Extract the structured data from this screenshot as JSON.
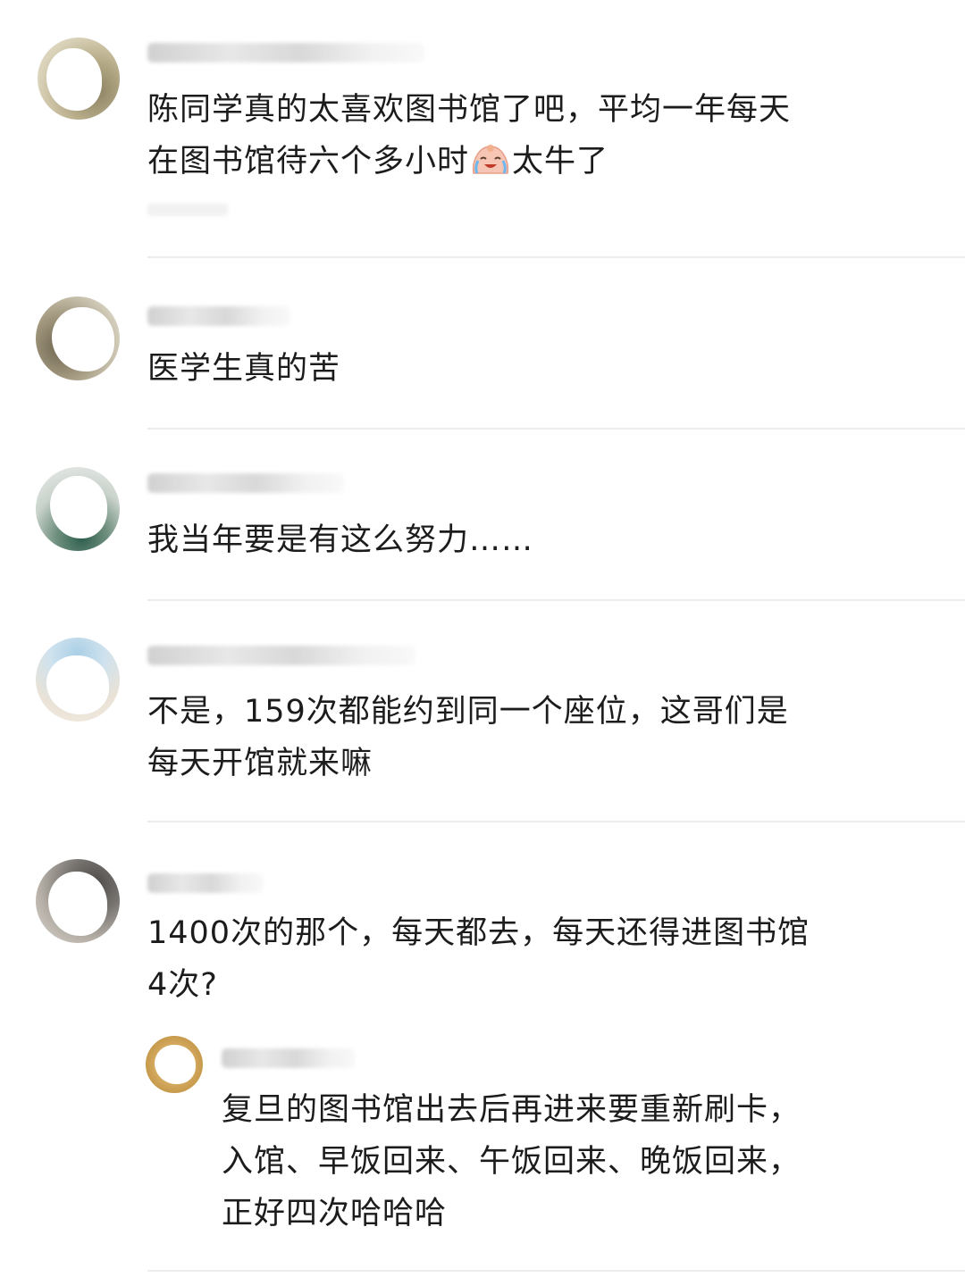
{
  "comments": [
    {
      "text_before_emoji": "陈同学真的太喜欢图书馆了吧，平均一年每天\n在图书馆待六个多小时",
      "emoji": "crying-laughing-emoji",
      "text_after_emoji": "太牛了"
    },
    {
      "text": "医学生真的苦"
    },
    {
      "text": "我当年要是有这么努力……"
    },
    {
      "text": "不是，159次都能约到同一个座位，这哥们是\n每天开馆就来嘛"
    },
    {
      "text": "1400次的那个，每天都去，每天还得进图书馆\n4次?",
      "reply": {
        "text": "复旦的图书馆出去后再进来要重新刷卡，\n入馆、早饭回来、午饭回来、晚饭回来，\n正好四次哈哈哈"
      }
    }
  ],
  "colors": {
    "text": "#1c1c1c",
    "divider": "#ececec",
    "background": "#ffffff"
  }
}
